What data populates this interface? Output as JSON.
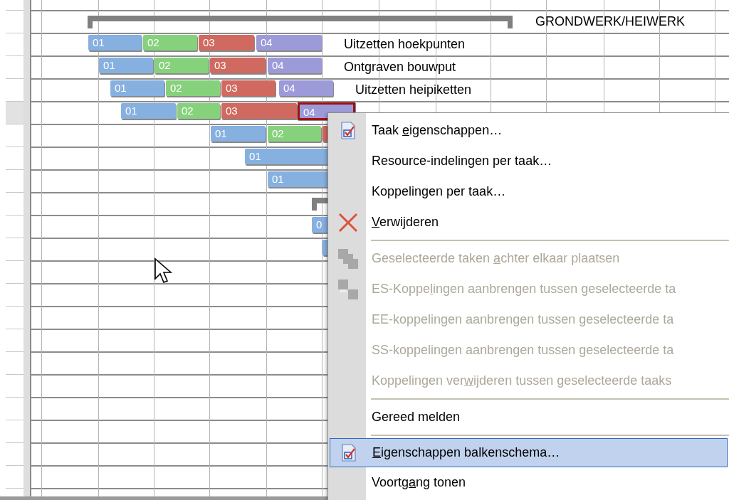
{
  "gantt": {
    "rows": [
      {
        "kind": "summary",
        "selected": false,
        "label": "GRONDWERK/HEIWERK"
      },
      {
        "kind": "task",
        "selected": false,
        "label": "Uitzetten hoekpunten",
        "segments": [
          {
            "label": "01",
            "color": "#86b0e0",
            "selected": false
          },
          {
            "label": "02",
            "color": "#86d27c",
            "selected": false
          },
          {
            "label": "03",
            "color": "#d0695f",
            "selected": false
          },
          {
            "label": "04",
            "color": "#9c9ad8",
            "selected": false
          }
        ]
      },
      {
        "kind": "task",
        "selected": false,
        "label": "Ontgraven bouwput",
        "segments": [
          {
            "label": "01",
            "color": "#86b0e0",
            "selected": false
          },
          {
            "label": "02",
            "color": "#86d27c",
            "selected": false
          },
          {
            "label": "03",
            "color": "#d0695f",
            "selected": false
          },
          {
            "label": "04",
            "color": "#9c9ad8",
            "selected": false
          }
        ]
      },
      {
        "kind": "task",
        "selected": false,
        "label": "Uitzetten heipiketten",
        "segments": [
          {
            "label": "01",
            "color": "#86b0e0",
            "selected": false
          },
          {
            "label": "02",
            "color": "#86d27c",
            "selected": false
          },
          {
            "label": "03",
            "color": "#d0695f",
            "selected": false
          },
          {
            "label": "04",
            "color": "#9c9ad8",
            "selected": false
          }
        ]
      },
      {
        "kind": "task",
        "selected": true,
        "segments": [
          {
            "label": "01",
            "color": "#86b0e0",
            "selected": false
          },
          {
            "label": "02",
            "color": "#86d27c",
            "selected": false
          },
          {
            "label": "03",
            "color": "#d0695f",
            "selected": false
          },
          {
            "label": "04",
            "color": "#9c9ad8",
            "selected": true
          }
        ]
      },
      {
        "kind": "task",
        "selected": false,
        "segments": [
          {
            "label": "01",
            "color": "#86b0e0",
            "selected": false
          },
          {
            "label": "02",
            "color": "#86d27c",
            "selected": false
          },
          {
            "color": "#d0695f",
            "selected": false
          }
        ]
      },
      {
        "kind": "task",
        "selected": false,
        "segments": [
          {
            "label": "01",
            "color": "#86b0e0",
            "selected": false
          }
        ]
      },
      {
        "kind": "task",
        "selected": false,
        "segments": [
          {
            "label": "01",
            "color": "#86b0e0",
            "selected": false
          }
        ]
      },
      {
        "kind": "summary",
        "selected": false
      },
      {
        "kind": "task",
        "selected": false,
        "segments": [
          {
            "label": "0",
            "color": "#86b0e0",
            "selected": false
          }
        ]
      },
      {
        "kind": "task",
        "selected": false,
        "segments": [
          {
            "color": "#86b0e0",
            "selected": false
          }
        ]
      }
    ]
  },
  "context_menu": {
    "items": [
      {
        "kind": "item",
        "before": "Taak ",
        "mnemonic": "e",
        "after": "igenschappen…",
        "disabled": false,
        "selected": false
      },
      {
        "kind": "item",
        "label": "Resource-indelingen per taak…",
        "disabled": false,
        "selected": false
      },
      {
        "kind": "item",
        "label": "Koppelingen per taak…",
        "disabled": false,
        "selected": false
      },
      {
        "kind": "item",
        "mnemonic": "V",
        "after": "erwijderen",
        "disabled": false,
        "selected": false
      },
      {
        "kind": "separator"
      },
      {
        "kind": "item",
        "before": "Geselecteerde taken ",
        "mnemonic": "a",
        "after": "chter elkaar plaatsen",
        "disabled": true,
        "selected": false
      },
      {
        "kind": "item",
        "before": "ES-Koppe",
        "mnemonic": "l",
        "after": "ingen aanbrengen tussen geselecteerde ta",
        "disabled": true,
        "selected": false
      },
      {
        "kind": "item",
        "label": "EE-koppelingen aanbrengen tussen geselecteerde ta",
        "disabled": true,
        "selected": false
      },
      {
        "kind": "item",
        "label": "SS-koppelingen aanbrengen tussen geselecteerde ta",
        "disabled": true,
        "selected": false
      },
      {
        "kind": "item",
        "before": "Koppelingen ver",
        "mnemonic": "w",
        "after": "ijderen tussen geselecteerde taaks",
        "disabled": true,
        "selected": false
      },
      {
        "kind": "separator"
      },
      {
        "kind": "item",
        "label": "Gereed melden",
        "disabled": false,
        "selected": false
      },
      {
        "kind": "separator"
      },
      {
        "kind": "item",
        "mnemonic": "E",
        "after": "igenschappen balkenschema…",
        "disabled": false,
        "selected": true
      },
      {
        "kind": "item",
        "before": "Voortg",
        "mnemonic": "a",
        "after": "ng tonen",
        "disabled": false,
        "selected": false
      }
    ]
  }
}
